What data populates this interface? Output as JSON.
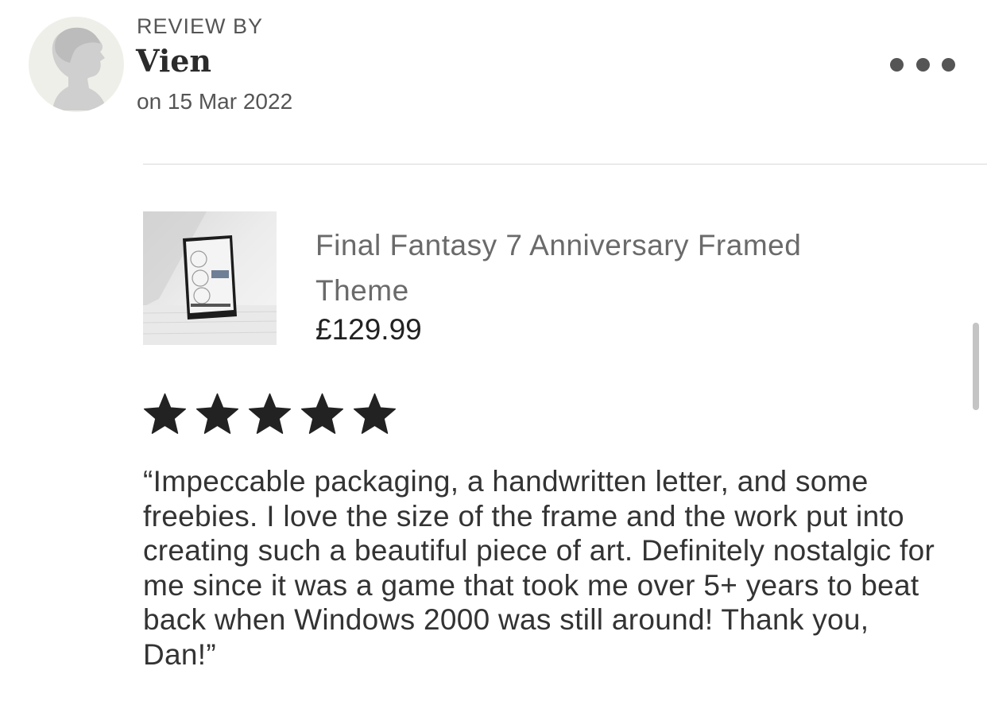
{
  "review": {
    "label": "REVIEW BY",
    "reviewer_name": "Vien",
    "date": "on 15 Mar 2022",
    "rating": 5,
    "rating_max": 5,
    "text": "“Impeccable packaging, a handwritten letter, and some freebies. I love the size of the frame and the work put into creating such a beautiful piece of art. Definitely nostalgic for me since it was a game that took me over 5+ years to beat back when Windows 2000 was still around! Thank you, Dan!”"
  },
  "product": {
    "title": "Final Fantasy 7 Anniversary Framed Theme",
    "price": "£129.99"
  },
  "icons": {
    "avatar": "default-person-avatar",
    "more": "more-horizontal-icon",
    "star": "star-filled-icon"
  },
  "colors": {
    "star": "#222222",
    "muted_text": "#6a6a6a",
    "avatar_bg": "#efefea"
  }
}
